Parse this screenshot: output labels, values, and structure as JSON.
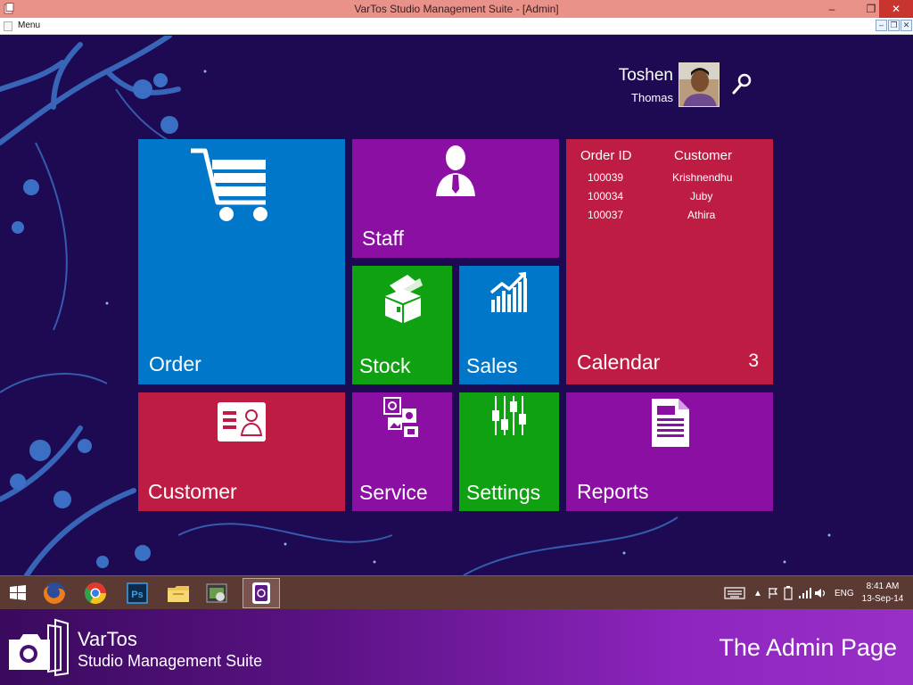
{
  "window": {
    "title": "VarTos Studio Management Suite  - [Admin]",
    "minimize": "–",
    "restore": "❐",
    "close": "✕"
  },
  "menubar": {
    "menu_label": "Menu",
    "mdi_minimize": "–",
    "mdi_restore": "❐",
    "mdi_close": "✕"
  },
  "user": {
    "first_name": "Toshen",
    "last_name": "Thomas"
  },
  "tiles": {
    "order": "Order",
    "staff": "Staff",
    "stock": "Stock",
    "sales": "Sales",
    "calendar": "Calendar",
    "calendar_count": "3",
    "customer": "Customer",
    "service": "Service",
    "settings": "Settings",
    "reports": "Reports"
  },
  "calendar_table": {
    "headers": [
      "Order ID",
      "Customer"
    ],
    "rows": [
      [
        "100039",
        "Krishnendhu"
      ],
      [
        "100034",
        "Juby"
      ],
      [
        "100037",
        "Athira"
      ]
    ]
  },
  "taskbar": {
    "lang": "ENG",
    "time": "8:41 AM",
    "date": "13-Sep-14"
  },
  "banner": {
    "brand": "VarTos",
    "tagline": "Studio Management Suite",
    "page_name": "The Admin Page"
  },
  "colors": {
    "background": "#1d0a52",
    "blue_tile": "#0077c8",
    "purple_tile": "#8a0fa2",
    "red_tile": "#be1c43",
    "green_tile": "#10a112",
    "title_bar": "#e8928a"
  },
  "icons": [
    "shopping-cart-icon",
    "person-icon",
    "stock-box-icon",
    "sales-chart-icon",
    "contact-card-icon",
    "service-media-icon",
    "sliders-icon",
    "document-icon",
    "search-icon",
    "camera-logo-icon"
  ]
}
